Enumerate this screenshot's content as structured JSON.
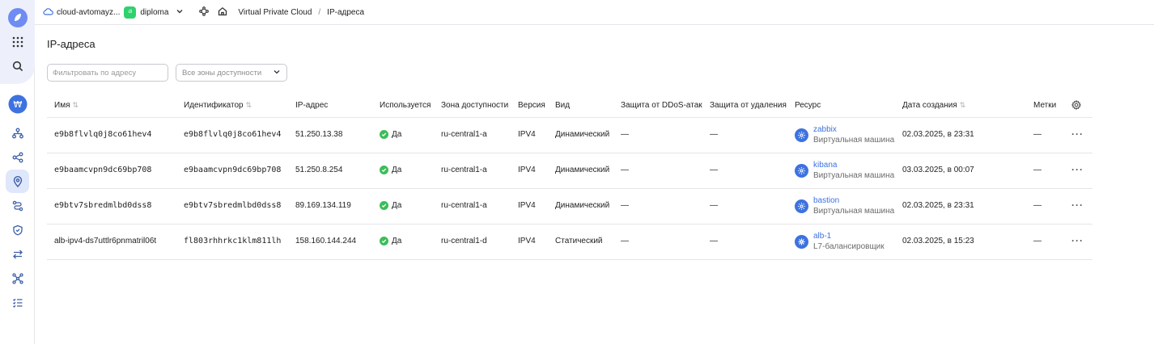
{
  "topbar": {
    "cloud_name": "cloud-avtomayz...",
    "folder_badge": "di",
    "folder_name": "diploma",
    "breadcrumb_service": "Virtual Private Cloud",
    "breadcrumb_sep": "/",
    "breadcrumb_current": "IP-адреса"
  },
  "page": {
    "title": "IP-адреса",
    "filter_placeholder": "Фильтровать по адресу",
    "zone_select_value": "Все зоны доступности"
  },
  "table": {
    "headers": {
      "name": "Имя",
      "id": "Идентификатор",
      "ip": "IP-адрес",
      "used": "Используется",
      "zone": "Зона доступности",
      "version": "Версия",
      "kind": "Вид",
      "ddos": "Защита от DDoS-атак",
      "deletion": "Защита от удаления",
      "resource": "Ресурс",
      "created": "Дата создания",
      "labels": "Метки"
    },
    "rows": [
      {
        "name": "e9b8flvlq0j8co61hev4",
        "id": "e9b8flvlq0j8co61hev4",
        "ip": "51.250.13.38",
        "used": "Да",
        "zone": "ru-central1-a",
        "version": "IPV4",
        "kind": "Динамический",
        "ddos": "—",
        "deletion": "—",
        "resource_name": "zabbix",
        "resource_type": "Виртуальная машина",
        "created": "02.03.2025, в 23:31",
        "labels": "—",
        "more": "···"
      },
      {
        "name": "e9baamcvpn9dc69bp708",
        "id": "e9baamcvpn9dc69bp708",
        "ip": "51.250.8.254",
        "used": "Да",
        "zone": "ru-central1-a",
        "version": "IPV4",
        "kind": "Динамический",
        "ddos": "—",
        "deletion": "—",
        "resource_name": "kibana",
        "resource_type": "Виртуальная машина",
        "created": "03.03.2025, в 00:07",
        "labels": "—",
        "more": "···"
      },
      {
        "name": "e9btv7sbredmlbd0dss8",
        "id": "e9btv7sbredmlbd0dss8",
        "ip": "89.169.134.119",
        "used": "Да",
        "zone": "ru-central1-a",
        "version": "IPV4",
        "kind": "Динамический",
        "ddos": "—",
        "deletion": "—",
        "resource_name": "bastion",
        "resource_type": "Виртуальная машина",
        "created": "02.03.2025, в 23:31",
        "labels": "—",
        "more": "···"
      },
      {
        "name": "alb-ipv4-ds7uttlr6pnmatril06t",
        "id": "fl803rhhrkc1klm811lh",
        "ip": "158.160.144.244",
        "used": "Да",
        "zone": "ru-central1-d",
        "version": "IPV4",
        "kind": "Статический",
        "ddos": "—",
        "deletion": "—",
        "resource_name": "alb-1",
        "resource_type": "L7-балансировщик",
        "created": "02.03.2025, в 15:23",
        "labels": "—",
        "more": "···"
      }
    ]
  },
  "colors": {
    "accent": "#3d72e0",
    "success": "#3bbd5a",
    "folder_badge": "#2fd16c",
    "logo": "#5f7ff0"
  },
  "icons": {
    "rail": [
      "logo-icon",
      "apps-grid-icon",
      "search-icon",
      "avatar-icon",
      "network-icon",
      "share-icon",
      "location-pin-icon",
      "routes-icon",
      "shield-icon",
      "transfer-icon",
      "topology-icon",
      "checklist-icon"
    ],
    "topbar": [
      "cloud-icon",
      "chevron-down-icon",
      "nodes-icon",
      "home-icon"
    ]
  }
}
